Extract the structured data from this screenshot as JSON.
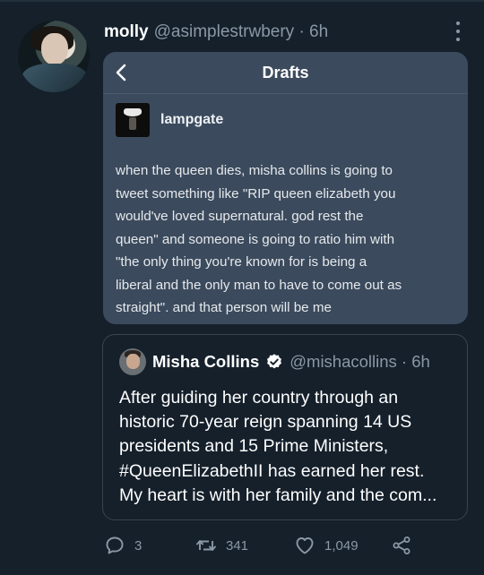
{
  "tweet": {
    "display_name": "molly",
    "handle_time": "@asimplestrwbery · 6h",
    "avatar_icon": "profile-photo"
  },
  "drafts_screenshot": {
    "title": "Drafts",
    "blog_name": "lampgate",
    "post_lines": [
      "when the queen dies, misha collins is going to",
      "tweet something like \"RIP queen elizabeth you",
      "would've loved supernatural. god rest the",
      "queen\" and someone is going to ratio him with",
      "\"the only thing you're known for is being a",
      "liberal and the only man to have to come out as",
      "straight\". and that person will be me"
    ]
  },
  "quoted_tweet": {
    "name": "Misha Collins",
    "handle_time": "@mishacollins · 6h",
    "verified": true,
    "lines": [
      "After guiding her country through an",
      "historic 70-year reign spanning 14 US",
      "presidents and 15 Prime Ministers,",
      "#QueenElizabethII has earned her rest.",
      "My heart is with her family and the com..."
    ]
  },
  "actions": {
    "replies": "3",
    "retweets": "341",
    "likes": "1,049"
  },
  "colors": {
    "background": "#15202b",
    "muted": "#8b98a5",
    "card": "#3b4a5d",
    "border": "#38444d",
    "verified": "#ffffff"
  }
}
